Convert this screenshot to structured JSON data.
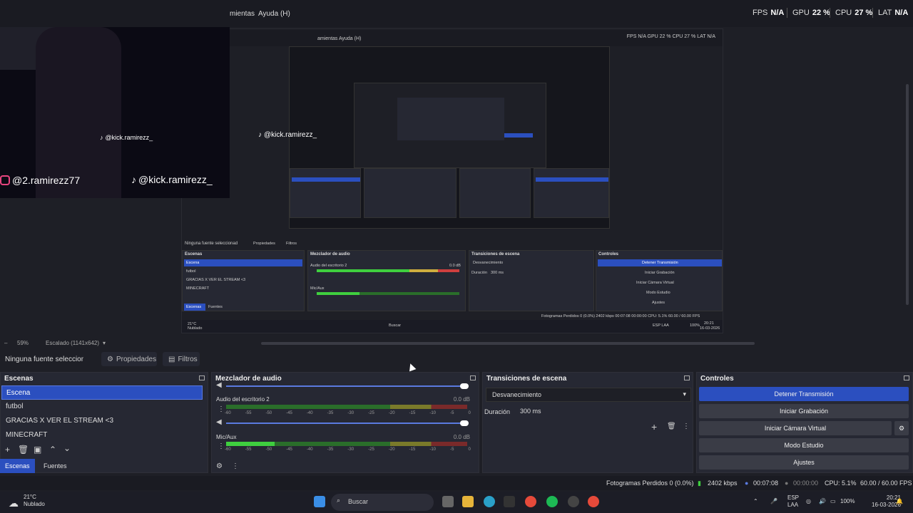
{
  "menubar": {
    "items": [
      "mientas",
      "Ayuda (H)"
    ]
  },
  "stats": {
    "fps_label": "FPS",
    "fps_value": "N/A",
    "gpu_label": "GPU",
    "gpu_value": "22 %",
    "cpu_label": "CPU",
    "cpu_value": "27 %",
    "lat_label": "LAT",
    "lat_value": "N/A"
  },
  "overlays": {
    "instagram": "@2.ramirezz77",
    "tiktok": "@kick.ramirezz_",
    "tiktok_small": "@kick.ramirezz_",
    "tiktok_tiny": "@kick.ramirezz_"
  },
  "capture": {
    "menu": "amientas    Ayuda (H)",
    "stats": "FPS N/A   GPU 22 %   CPU 27 %   LAT N/A",
    "no_source": "Ninguna fuente seleccionad",
    "props": "Propiedades",
    "filters": "Filtros",
    "scenes_title": "Escenas",
    "mixer_title": "Mezclador de audio",
    "transitions_title": "Transiciones de escena",
    "controls_title": "Controles",
    "scenes": [
      "Escena",
      "futbol",
      "GRACIAS X VER EL STREAM <3",
      "MINECRAFT"
    ],
    "desktop_audio": "Audio del escritorio 2",
    "db": "0.0 dB",
    "mic": "Mic/Aux",
    "fade": "Desvanecimiento",
    "duration_label": "Duración",
    "duration": "300 ms",
    "stop": "Detener Transmisión",
    "rec": "Iniciar Grabación",
    "vcam": "Iniciar Cámara Virtual",
    "studio": "Modo Estudio",
    "settings": "Ajustes",
    "tab_scenes": "Escenas",
    "tab_sources": "Fuentes",
    "zoom": "59%",
    "scaled": "Escalado (1141x642)",
    "status": "Fotogramas Perdidos 0 (0.0%)   2402 kbps   00:07:08   00:00:00   CPU: 5.1%   60.00 / 60.00 FPS",
    "temp": "21°C",
    "weather": "Nublado",
    "search": "Buscar",
    "lang": "ESP LAA",
    "battery": "100%",
    "time": "20:21",
    "date": "16-03-2026"
  },
  "zoom": {
    "percent": "59%",
    "scaled": "Escalado (1141x642)"
  },
  "source_bar": {
    "no_source": "Ninguna fuente seleccionad",
    "properties": "Propiedades",
    "filters": "Filtros"
  },
  "scenes": {
    "title": "Escenas",
    "items": [
      "Escena",
      "futbol",
      "GRACIAS X VER EL STREAM <3",
      "MINECRAFT"
    ],
    "tab_scenes": "Escenas",
    "tab_sources": "Fuentes"
  },
  "mixer": {
    "title": "Mezclador de audio",
    "channels": [
      {
        "name": "Audio del escritorio 2",
        "db": "0.0 dB"
      },
      {
        "name": "Mic/Aux",
        "db": "0.0 dB"
      }
    ],
    "scale": [
      "-60",
      "-55",
      "-50",
      "-45",
      "-40",
      "-35",
      "-30",
      "-25",
      "-20",
      "-15",
      "-10",
      "-5",
      "0"
    ]
  },
  "transitions": {
    "title": "Transiciones de escena",
    "selected": "Desvanecimiento",
    "duration_label": "Duración",
    "duration_value": "300 ms"
  },
  "controls": {
    "title": "Controles",
    "stop_stream": "Detener Transmisión",
    "start_recording": "Iniciar Grabación",
    "start_vcam": "Iniciar Cámara Virtual",
    "studio_mode": "Modo Estudio",
    "settings": "Ajustes"
  },
  "status": {
    "dropped": "Fotogramas Perdidos 0 (0.0%)",
    "bitrate": "2402 kbps",
    "stream_time": "00:07:08",
    "rec_time": "00:00:00",
    "cpu": "CPU: 5.1%",
    "fps": "60.00 / 60.00 FPS"
  },
  "taskbar": {
    "temp": "21°C",
    "weather": "Nublado",
    "search": "Buscar",
    "lang1": "ESP",
    "lang2": "LAA",
    "battery": "100%",
    "time": "20:21",
    "date": "16-03-2026"
  },
  "colors": {
    "accent": "#2b4fbf",
    "bg": "#1e1f26",
    "panel": "#262833"
  }
}
